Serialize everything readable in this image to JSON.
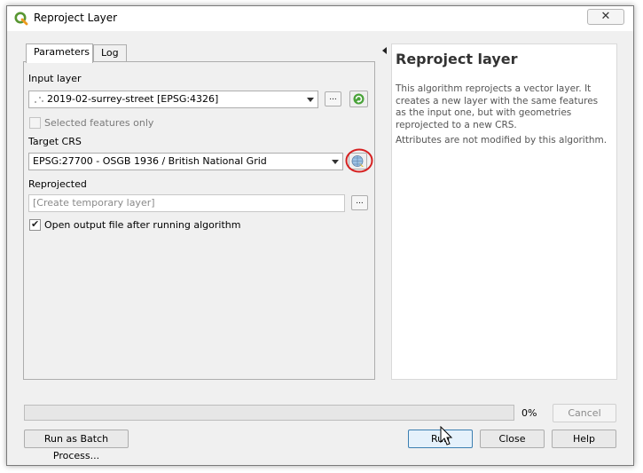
{
  "window": {
    "title": "Reproject Layer",
    "close_label": "✕",
    "icon": "qgis-logo-icon",
    "accent_color": "#3c7fb1"
  },
  "tabs": [
    {
      "label": "Parameters",
      "active": true
    },
    {
      "label": "Log",
      "active": false
    }
  ],
  "parameters": {
    "input_layer_label": "Input layer",
    "input_layer_value": "2019-02-surrey-street [EPSG:4326]",
    "input_layer_browse_label": "...",
    "selected_features_label": "Selected features only",
    "selected_features_checked": false,
    "target_crs_label": "Target CRS",
    "target_crs_value": "EPSG:27700 - OSGB 1936 / British National Grid",
    "reprojected_label": "Reprojected",
    "reprojected_placeholder": "[Create temporary layer]",
    "reprojected_browse_label": "...",
    "open_output_label": "Open output file after running algorithm",
    "open_output_checked": true
  },
  "help": {
    "title": "Reproject layer",
    "paragraph1": "This algorithm reprojects a vector layer. It creates a new layer with the same features as the input one, but with geometries reprojected to a new CRS.",
    "paragraph2": "Attributes are not modified by this algorithm."
  },
  "progress": {
    "value": 0,
    "label": "0%"
  },
  "buttons": {
    "cancel": "Cancel",
    "batch": "Run as Batch Process...",
    "run": "Run",
    "close": "Close",
    "help": "Help"
  },
  "annotations": {
    "highlight_color": "#d62020"
  }
}
